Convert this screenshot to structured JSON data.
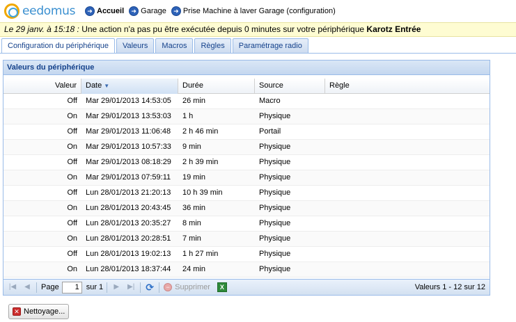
{
  "logo": {
    "text": "eedomus"
  },
  "breadcrumb": [
    {
      "label": "Accueil",
      "bold": true
    },
    {
      "label": "Garage",
      "bold": false
    },
    {
      "label": "Prise Machine à laver Garage (configuration)",
      "bold": false
    }
  ],
  "alert": {
    "date": "Le 29 janv. à 15:18 :",
    "message": " Une action n'a pas pu être exécutée depuis 0 minutes sur votre périphérique ",
    "device": "Karotz Entrée"
  },
  "tabs": [
    {
      "label": "Configuration du périphérique",
      "active": true
    },
    {
      "label": "Valeurs",
      "active": false
    },
    {
      "label": "Macros",
      "active": false
    },
    {
      "label": "Règles",
      "active": false
    },
    {
      "label": "Paramétrage radio",
      "active": false
    }
  ],
  "panel": {
    "title": "Valeurs du périphérique",
    "columns": {
      "value": "Valeur",
      "date": "Date",
      "duration": "Durée",
      "source": "Source",
      "rule": "Règle"
    },
    "sort_arrow": "▼",
    "rows": [
      {
        "value": "Off",
        "date": "Mar 29/01/2013 14:53:05",
        "duration": "26 min",
        "source": "Macro",
        "rule": ""
      },
      {
        "value": "On",
        "date": "Mar 29/01/2013 13:53:03",
        "duration": "1 h",
        "source": "Physique",
        "rule": ""
      },
      {
        "value": "Off",
        "date": "Mar 29/01/2013 11:06:48",
        "duration": "2 h 46 min",
        "source": "Portail",
        "rule": ""
      },
      {
        "value": "On",
        "date": "Mar 29/01/2013 10:57:33",
        "duration": "9 min",
        "source": "Physique",
        "rule": ""
      },
      {
        "value": "Off",
        "date": "Mar 29/01/2013 08:18:29",
        "duration": "2 h 39 min",
        "source": "Physique",
        "rule": ""
      },
      {
        "value": "On",
        "date": "Mar 29/01/2013 07:59:11",
        "duration": "19 min",
        "source": "Physique",
        "rule": ""
      },
      {
        "value": "Off",
        "date": "Lun 28/01/2013 21:20:13",
        "duration": "10 h 39 min",
        "source": "Physique",
        "rule": ""
      },
      {
        "value": "On",
        "date": "Lun 28/01/2013 20:43:45",
        "duration": "36 min",
        "source": "Physique",
        "rule": ""
      },
      {
        "value": "Off",
        "date": "Lun 28/01/2013 20:35:27",
        "duration": "8 min",
        "source": "Physique",
        "rule": ""
      },
      {
        "value": "On",
        "date": "Lun 28/01/2013 20:28:51",
        "duration": "7 min",
        "source": "Physique",
        "rule": ""
      },
      {
        "value": "Off",
        "date": "Lun 28/01/2013 19:02:13",
        "duration": "1 h 27 min",
        "source": "Physique",
        "rule": ""
      },
      {
        "value": "On",
        "date": "Lun 28/01/2013 18:37:44",
        "duration": "24 min",
        "source": "Physique",
        "rule": ""
      }
    ]
  },
  "pager": {
    "page_label": "Page",
    "page_value": "1",
    "of_label": "sur 1",
    "delete_label": "Supprimer",
    "info": "Valeurs 1 - 12 sur 12"
  },
  "cleanup": {
    "label": "Nettoyage..."
  },
  "icons": {
    "nav": "arrow-circle-icon",
    "refresh": "refresh-icon",
    "delete": "delete-icon",
    "export": "excel-icon",
    "cleanup": "red-x-icon"
  }
}
